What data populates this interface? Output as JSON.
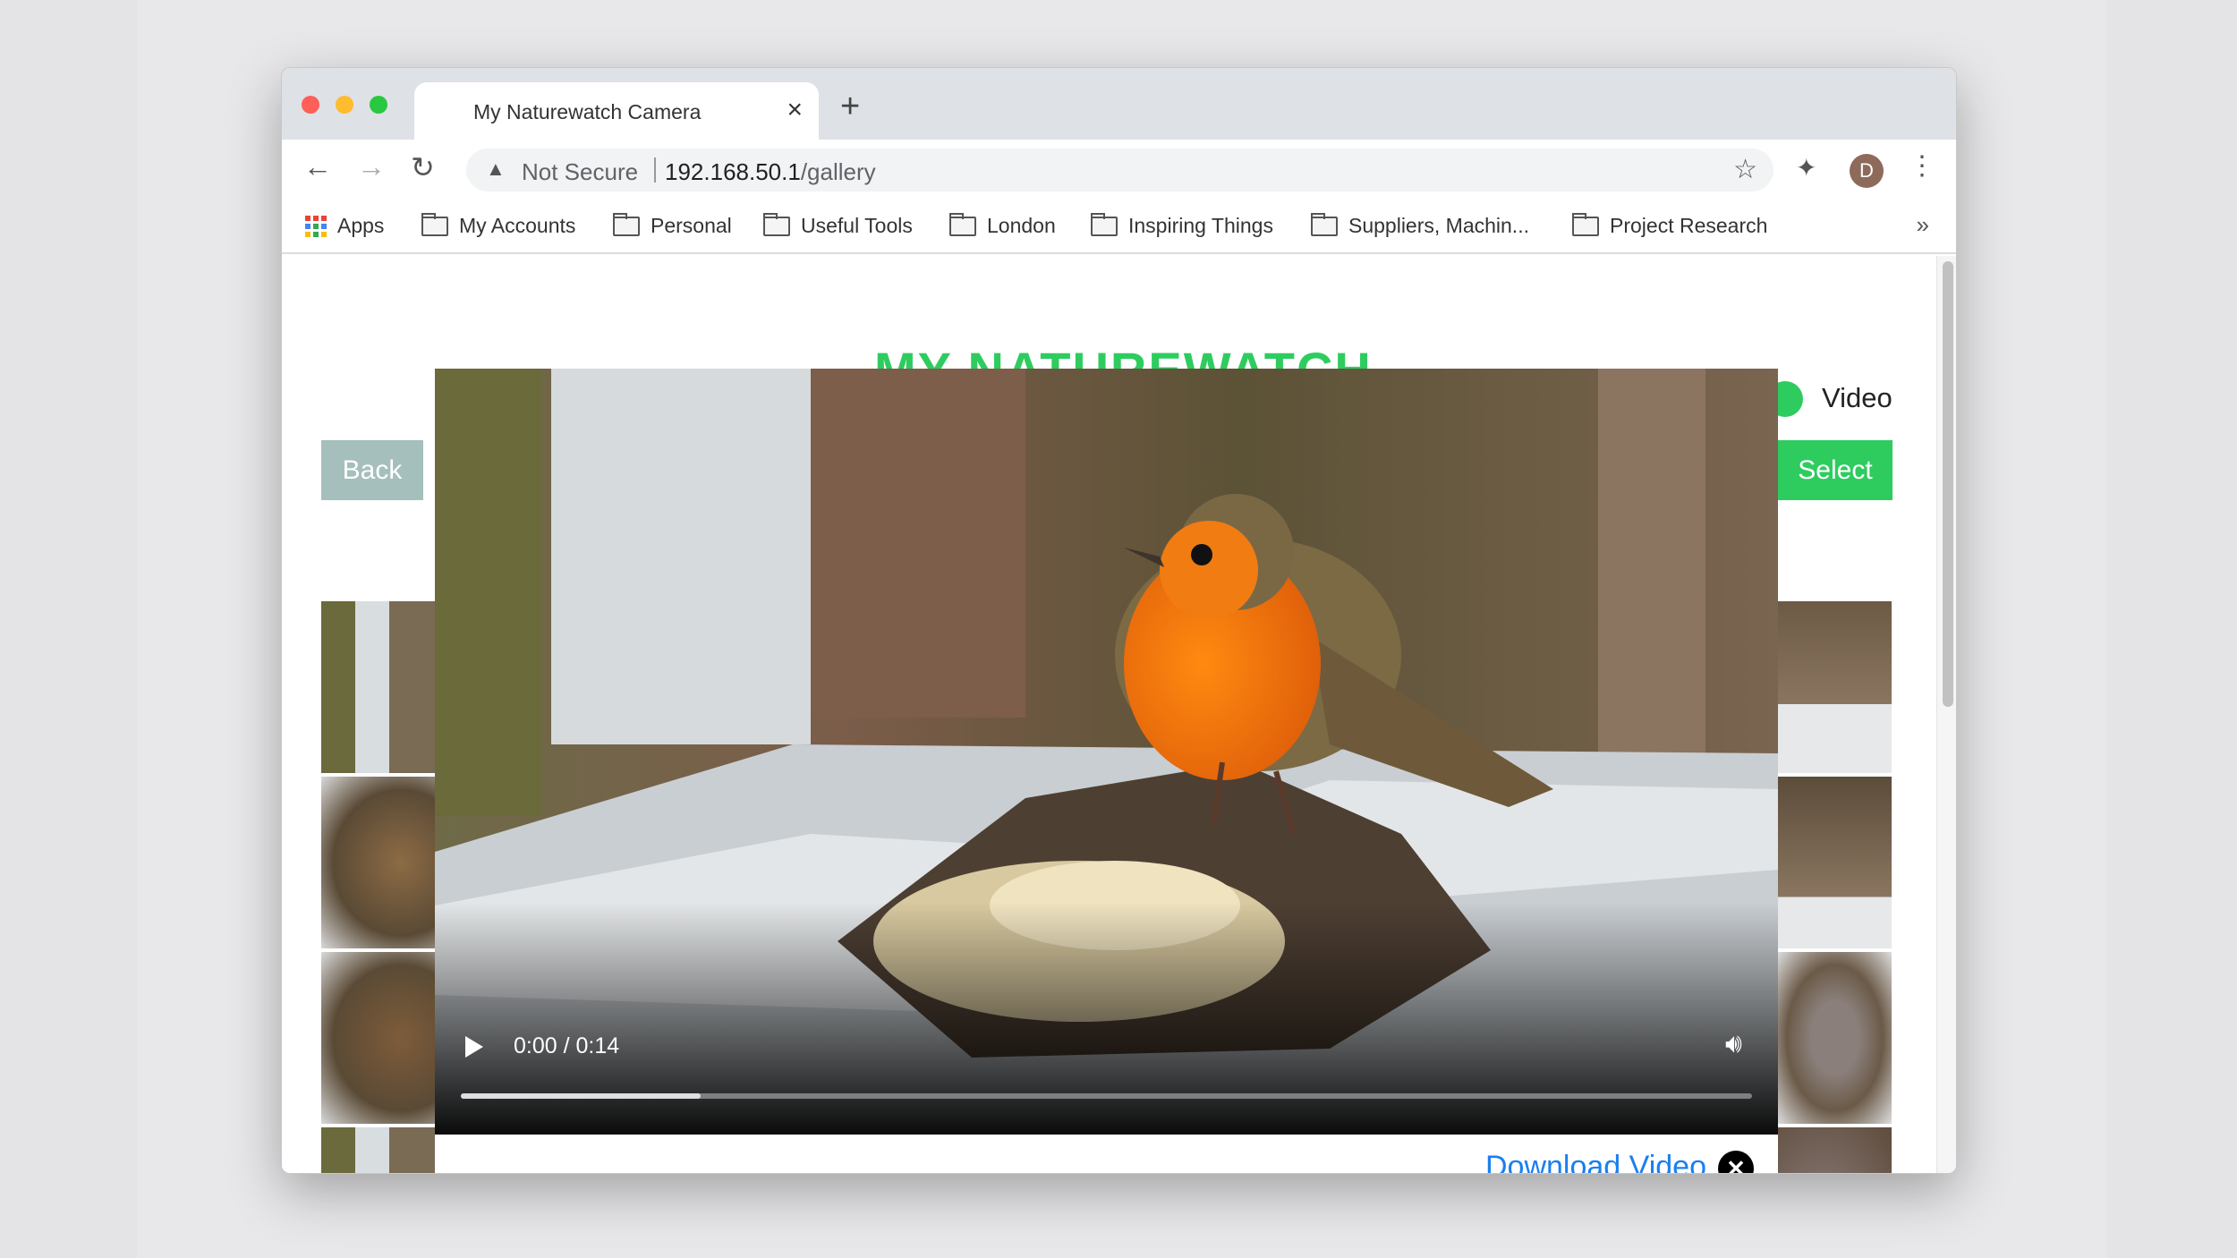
{
  "browser": {
    "tab_title": "My Naturewatch Camera",
    "security_label": "Not Secure",
    "url_host": "192.168.50.1",
    "url_path": "/gallery",
    "profile_initial": "D",
    "bookmarks": [
      "Apps",
      "My Accounts",
      "Personal",
      "Useful Tools",
      "London",
      "Inspiring Things",
      "Suppliers, Machin...",
      "Project Research"
    ]
  },
  "page": {
    "site_title": "MY NATUREWATCH",
    "back_label": "Back",
    "select_label": "Select",
    "toggle_label": "Video",
    "accent_color": "#2ecc5f"
  },
  "player": {
    "time": "0:00 / 0:14",
    "buffered_percent": 18.6,
    "download_label": "Download Video"
  }
}
